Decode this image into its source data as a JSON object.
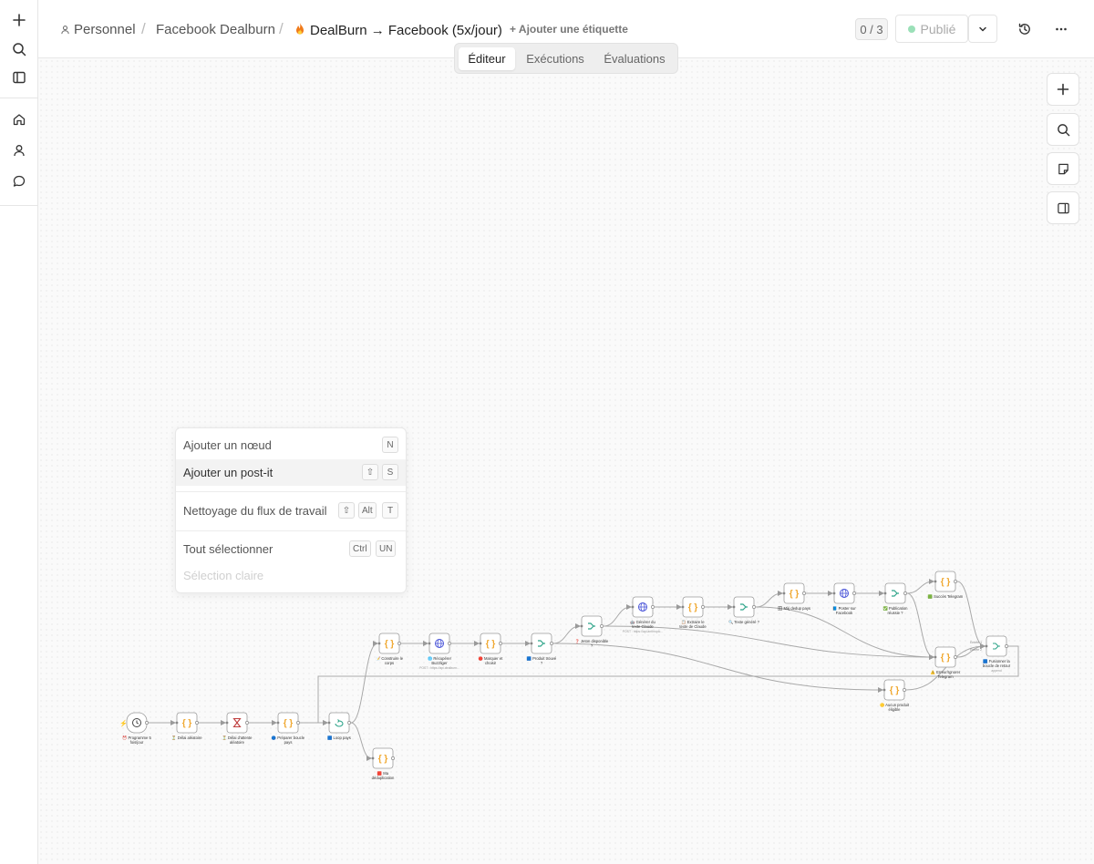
{
  "rail": {
    "items": [
      {
        "icon": "plus-icon"
      },
      {
        "icon": "search-icon"
      },
      {
        "icon": "panel-icon"
      },
      {
        "icon": "home-icon"
      },
      {
        "icon": "user-icon"
      },
      {
        "icon": "chat-icon"
      }
    ]
  },
  "header": {
    "breadcrumb": {
      "personal": "Personnel",
      "folder": "Facebook Dealburn",
      "workflow": "DealBurn → Facebook (5x/jour)"
    },
    "add_tag": "+ Ajouter une étiquette",
    "count": "0 / 3",
    "publish_label": "Publié"
  },
  "tabs": [
    "Éditeur",
    "Exécutions",
    "Évaluations"
  ],
  "context_menu": {
    "add_node": {
      "label": "Ajouter un nœud",
      "keys": [
        "N"
      ]
    },
    "add_note": {
      "label": "Ajouter un post-it",
      "keys": [
        "⇧",
        "S"
      ]
    },
    "tidy": {
      "label": "Nettoyage du flux de travail",
      "keys": [
        "⇧",
        "Alt",
        "T"
      ]
    },
    "select_all": {
      "label": "Tout sélectionner",
      "keys": [
        "Ctrl",
        "UN"
      ]
    },
    "clear_selection": {
      "label": "Sélection claire"
    }
  },
  "workflow": {
    "nodes": [
      {
        "id": "n1",
        "label": "⏰ Programme 5 fois/jour",
        "icon": "clock",
        "color": "#444"
      },
      {
        "id": "n2",
        "label": "⏳ Délai aléatoire",
        "icon": "code",
        "color": "#f0a830"
      },
      {
        "id": "n3",
        "label": "⏳ Délai d'attente aléatoire",
        "icon": "hourglass",
        "color": "#c04040"
      },
      {
        "id": "n4",
        "label": "🔵 Préparer boucle pays",
        "icon": "code",
        "color": "#f0a830"
      },
      {
        "id": "n5",
        "label": "🟦 Loop pays",
        "icon": "loop",
        "color": "#2fa58a"
      },
      {
        "id": "n6",
        "label": "🟥 Ma déduplication",
        "icon": "code",
        "color": "#f0a830"
      },
      {
        "id": "n7",
        "label": "📝 Construire le corps",
        "icon": "code",
        "color": "#f0a830"
      },
      {
        "id": "n8",
        "label": "🌐 Récupérer Buzzliger",
        "sub": "POST : https://api.dealburn...",
        "icon": "globe",
        "color": "#4a55d8"
      },
      {
        "id": "n9",
        "label": "🔴 Marquer et choisir",
        "icon": "code",
        "color": "#f0a830"
      },
      {
        "id": "n10",
        "label": "🟦 Produit trouvé ?",
        "icon": "if",
        "color": "#2fa58a"
      },
      {
        "id": "n11",
        "label": "❓ Jeton disponible ?",
        "icon": "if",
        "color": "#2fa58a"
      },
      {
        "id": "n12",
        "label": "🤖 Générer du texte Claude",
        "sub": "POST : https://api.anthropic...",
        "icon": "globe",
        "color": "#4a55d8"
      },
      {
        "id": "n13",
        "label": "📋 Extraire le texte de Claude",
        "icon": "code",
        "color": "#f0a830"
      },
      {
        "id": "n14",
        "label": "🔍 Texte généré ?",
        "icon": "if",
        "color": "#2fa58a"
      },
      {
        "id": "n15",
        "label": "🗄 Màj dedup pays",
        "icon": "code",
        "color": "#f0a830"
      },
      {
        "id": "n16",
        "label": "📘 Poster sur Facebook",
        "icon": "globe",
        "color": "#4a55d8"
      },
      {
        "id": "n17",
        "label": "✅ Publication réussie ?",
        "icon": "if",
        "color": "#2fa58a"
      },
      {
        "id": "n18",
        "label": "🟩 Succès Telegram",
        "icon": "code",
        "color": "#f0a830"
      },
      {
        "id": "n19",
        "label": "⚠️ Erreur/Ignorer Telegram",
        "icon": "code",
        "color": "#f0a830"
      },
      {
        "id": "n20",
        "label": "🟦 Fusionner la boucle de retour",
        "sub": "append",
        "icon": "merge",
        "color": "#2fa58a"
      },
      {
        "id": "n21",
        "label": "🟡 Aucun produit éligible",
        "icon": "code",
        "color": "#f0a830"
      }
    ],
    "edges": [
      [
        "n1",
        "n2"
      ],
      [
        "n2",
        "n3"
      ],
      [
        "n3",
        "n4"
      ],
      [
        "n4",
        "n5"
      ],
      [
        "n5",
        "n7"
      ],
      [
        "n5",
        "n6"
      ],
      [
        "n7",
        "n8"
      ],
      [
        "n8",
        "n9"
      ],
      [
        "n9",
        "n10"
      ],
      [
        "n10",
        "n11"
      ],
      [
        "n10",
        "n21"
      ],
      [
        "n11",
        "n12"
      ],
      [
        "n11",
        "n19"
      ],
      [
        "n12",
        "n13"
      ],
      [
        "n13",
        "n14"
      ],
      [
        "n14",
        "n15"
      ],
      [
        "n14",
        "n19"
      ],
      [
        "n15",
        "n16"
      ],
      [
        "n16",
        "n17"
      ],
      [
        "n17",
        "n18"
      ],
      [
        "n17",
        "n19"
      ],
      [
        "n18",
        "n20"
      ],
      [
        "n19",
        "n20"
      ],
      [
        "n21",
        "n20"
      ],
      [
        "n20",
        "n5"
      ]
    ],
    "port_labels": {
      "n20_in1": "Entrée 1",
      "n20_in2": "Entrée 2"
    }
  }
}
